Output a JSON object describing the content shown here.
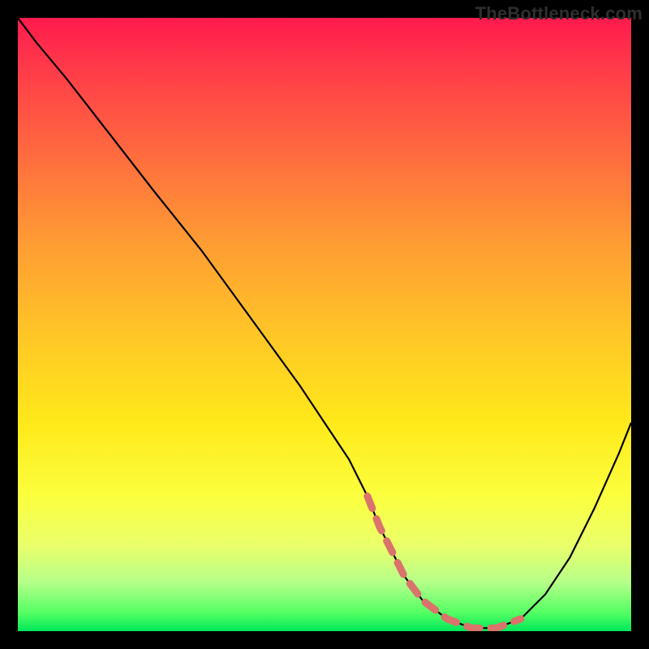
{
  "watermark": "TheBottleneck.com",
  "chart_data": {
    "type": "line",
    "title": "",
    "xlabel": "",
    "ylabel": "",
    "xlim": [
      0,
      100
    ],
    "ylim": [
      0,
      100
    ],
    "series": [
      {
        "name": "curve",
        "x": [
          0,
          3,
          8,
          15,
          22,
          30,
          38,
          46,
          50,
          54,
          57,
          59,
          61,
          63,
          66,
          70,
          74,
          78,
          82,
          86,
          90,
          94,
          98,
          100
        ],
        "values": [
          100,
          96,
          90,
          81,
          72,
          62,
          51,
          40,
          34,
          28,
          22,
          17,
          13,
          9,
          5,
          2,
          0.5,
          0.5,
          2,
          6,
          12,
          20,
          29,
          34
        ]
      },
      {
        "name": "highlight-band",
        "x": [
          57,
          59,
          61,
          63,
          66,
          70,
          74,
          78,
          82
        ],
        "values": [
          22,
          17,
          13,
          9,
          5,
          2,
          0.5,
          0.5,
          2
        ]
      }
    ],
    "gradient_stops": [
      {
        "pos": 0,
        "color": "#ff1a4e"
      },
      {
        "pos": 8,
        "color": "#ff3a49"
      },
      {
        "pos": 22,
        "color": "#ff6a3f"
      },
      {
        "pos": 36,
        "color": "#ff9a34"
      },
      {
        "pos": 52,
        "color": "#ffc726"
      },
      {
        "pos": 66,
        "color": "#ffe91a"
      },
      {
        "pos": 78,
        "color": "#fbff3e"
      },
      {
        "pos": 86,
        "color": "#eaff6a"
      },
      {
        "pos": 92,
        "color": "#b6ff8a"
      },
      {
        "pos": 97,
        "color": "#54ff62"
      },
      {
        "pos": 100,
        "color": "#00e85a"
      }
    ],
    "colors": {
      "curve": "#000000",
      "highlight": "#d9736b",
      "frame": "#000000"
    }
  }
}
